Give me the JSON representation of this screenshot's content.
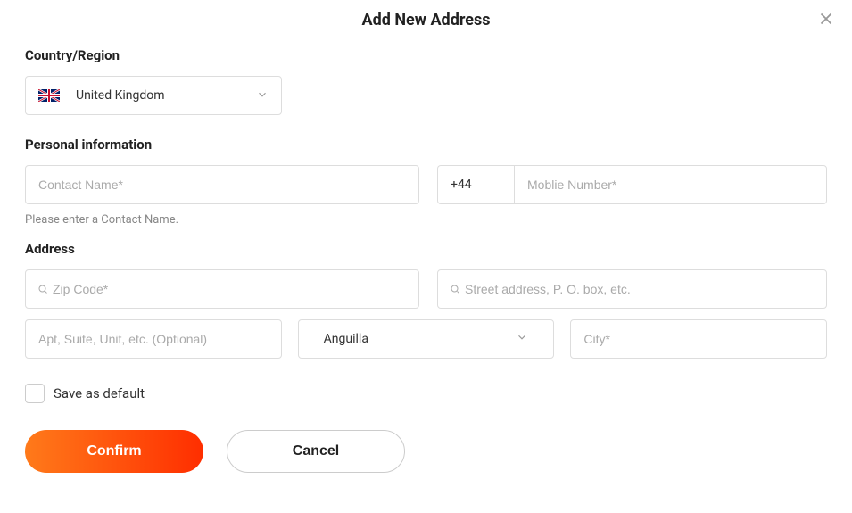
{
  "modal": {
    "title": "Add New Address"
  },
  "sections": {
    "country_label": "Country/Region",
    "personal_label": "Personal information",
    "address_label": "Address"
  },
  "country": {
    "selected": "United Kingdom"
  },
  "personal": {
    "contact_placeholder": "Contact Name*",
    "phone_prefix": "+44",
    "phone_placeholder": "Moblie Number*",
    "helper_text": "Please enter a Contact Name."
  },
  "address": {
    "zip_placeholder": "Zip Code*",
    "street_placeholder": "Street address, P. O. box, etc.",
    "apt_placeholder": "Apt, Suite, Unit, etc. (Optional)",
    "state_selected": "Anguilla",
    "city_placeholder": "City*"
  },
  "save_default_label": "Save as default",
  "buttons": {
    "confirm": "Confirm",
    "cancel": "Cancel"
  }
}
